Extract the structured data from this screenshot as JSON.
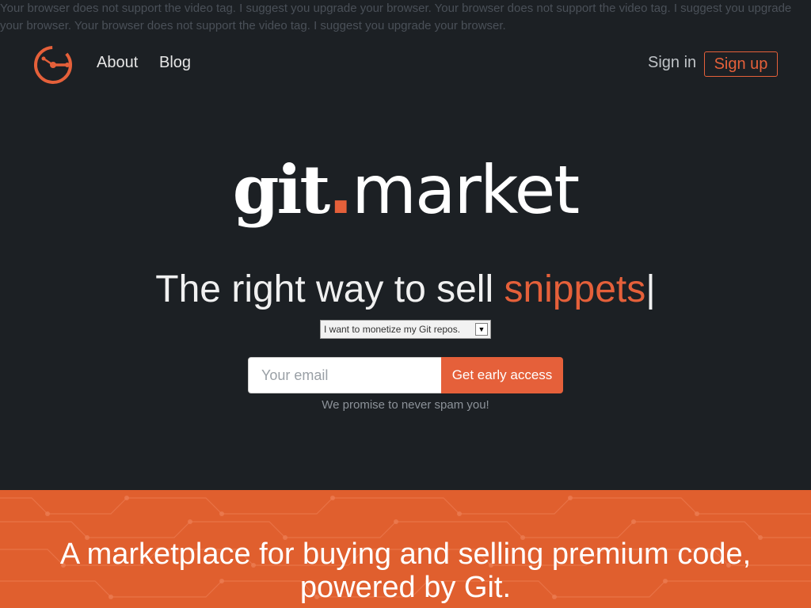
{
  "fallback_text": "Your browser does not support the video tag. I suggest you upgrade your browser. Your browser does not support the video tag. I suggest you upgrade your browser. Your browser does not support the video tag. I suggest you upgrade your browser.",
  "nav": {
    "about": "About",
    "blog": "Blog",
    "sign_in": "Sign in",
    "sign_up": "Sign up"
  },
  "brand": {
    "part1": "git",
    "dot": ".",
    "part2": "market"
  },
  "tagline": {
    "prefix": "The right way to sell ",
    "accent": "snippets",
    "cursor": "|"
  },
  "select": {
    "selected": "I want to monetize my Git repos.",
    "arrow": "▼"
  },
  "signup_form": {
    "email_placeholder": "Your email",
    "cta_label": "Get early access",
    "promise": "We promise to never spam you!"
  },
  "band": {
    "line1": "A marketplace for buying and selling premium code,",
    "line2": "powered by Git."
  },
  "colors": {
    "accent": "#e5603a",
    "background": "#1c2024",
    "band": "#e05f2e"
  },
  "icons": {
    "logo": "git-market-logo-icon",
    "select_arrow": "chevron-down-icon"
  }
}
